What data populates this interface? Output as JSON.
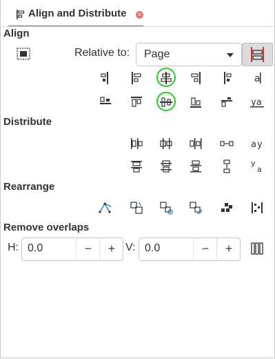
{
  "tab": {
    "title": "Align and Distribute",
    "close_glyph": "×"
  },
  "sections": {
    "align": "Align",
    "distribute": "Distribute",
    "rearrange": "Rearrange",
    "remove_overlaps": "Remove overlaps"
  },
  "align": {
    "relative_label": "Relative to:",
    "relative_value": "Page",
    "text_baseline_1": "a",
    "text_baseline_2": "ya"
  },
  "distribute": {
    "text_baseline_1": "a",
    "text_baseline_2": "a"
  },
  "overlaps": {
    "h_label": "H:",
    "h_value": "0.0",
    "v_label": "V:",
    "v_value": "0.0",
    "minus": "−",
    "plus": "+"
  },
  "colors": {
    "accent_underline": "#d9502a",
    "highlight_circle": "#22d022",
    "toggle_red": "#d03030",
    "rearrange_blue": "#1a74b8"
  }
}
